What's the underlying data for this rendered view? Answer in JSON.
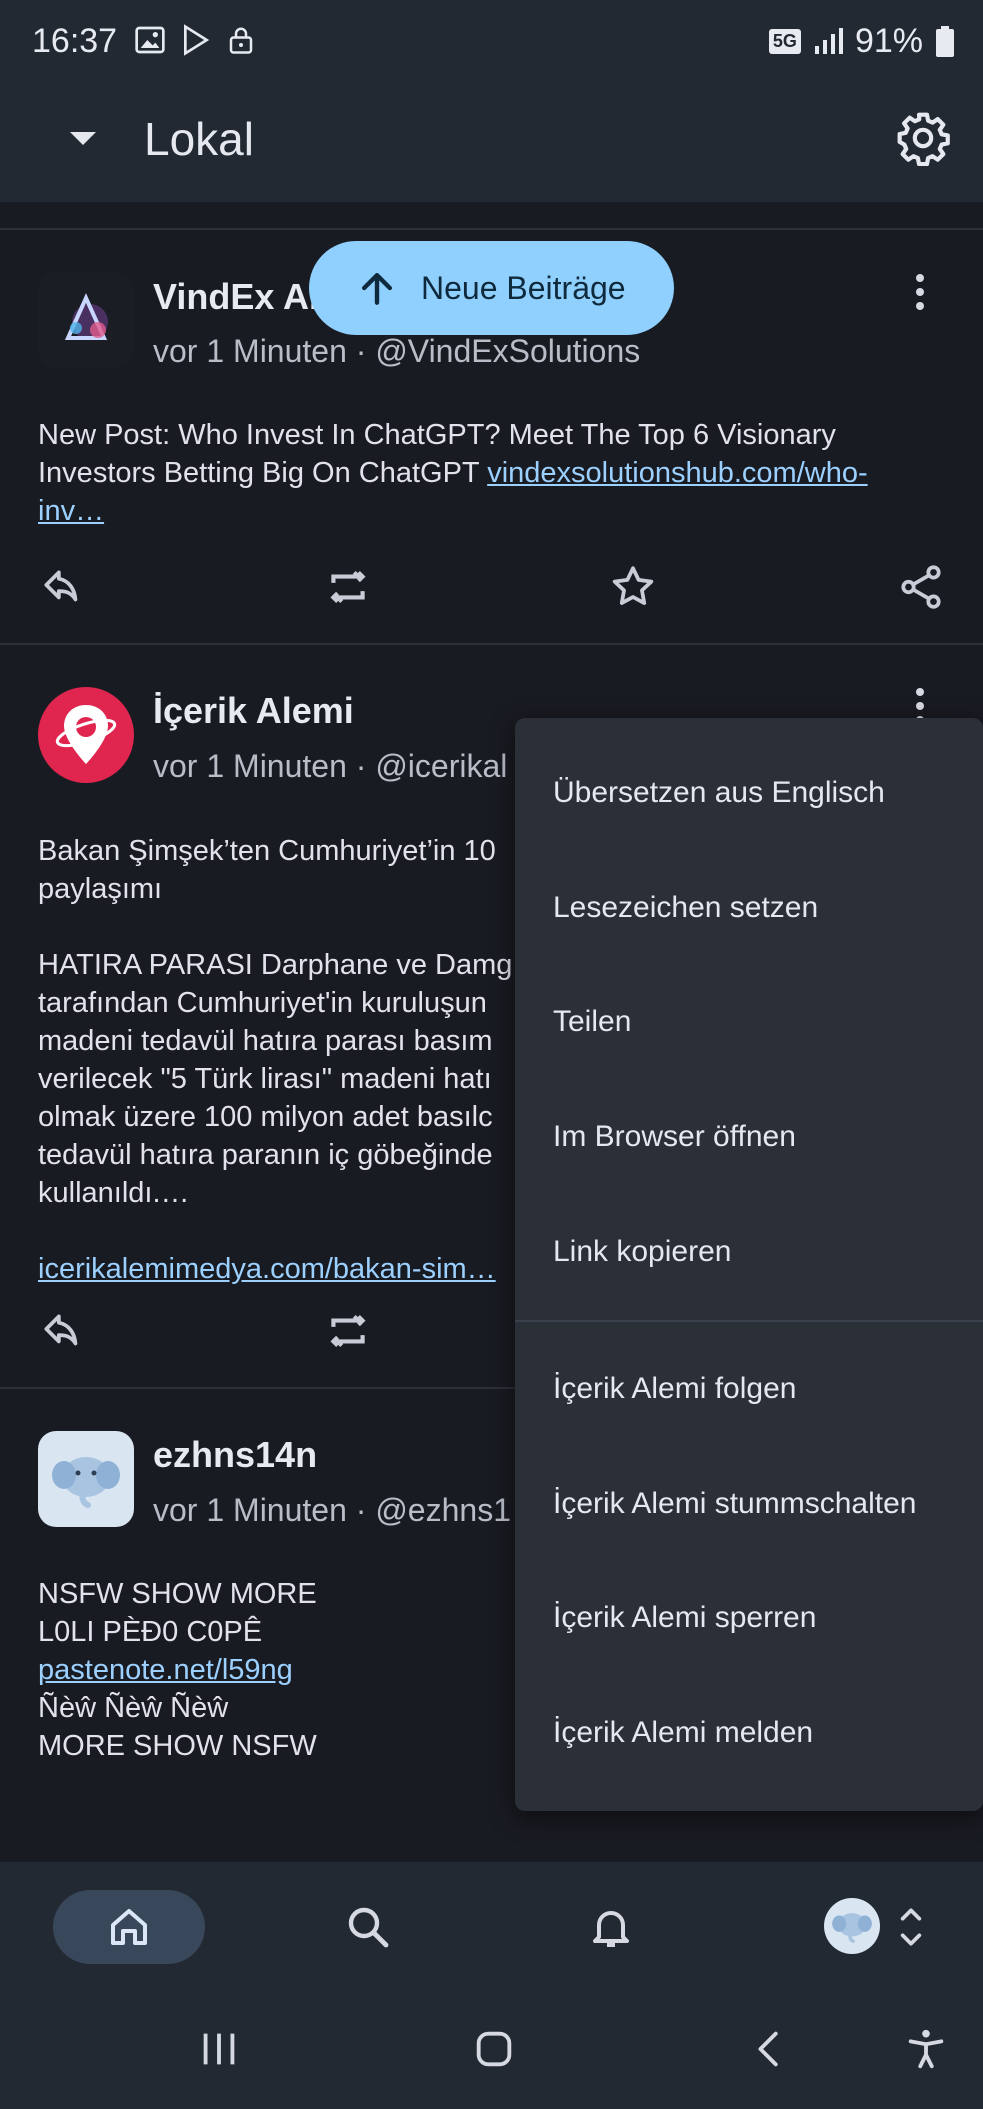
{
  "status_bar": {
    "time": "16:37",
    "network": "5G",
    "battery": "91%"
  },
  "app_bar": {
    "title": "Lokal"
  },
  "new_posts_pill": {
    "label": "Neue Beiträge"
  },
  "posts": [
    {
      "name": "VindEx AI",
      "time": "vor 1 Minuten",
      "handle": "@VindExSolutions",
      "text": "New Post: Who Invest In ChatGPT? Meet The Top 6 Visionary Investors Betting Big On ChatGPT ",
      "link": "vindexsolutionshub.com/who-inv…"
    },
    {
      "name": "İçerik Alemi",
      "time": "vor 1 Minuten",
      "handle": "@icerikal",
      "text_lines": [
        "Bakan Şimşek’ten Cumhuriyet’in 10",
        "paylaşımı",
        "",
        "HATIRA PARASI Darphane ve Damg",
        "tarafından Cumhuriyet'in kuruluşun",
        "madeni tedavül hatıra parası basım",
        "verilecek \"5 Türk lirası\" madeni hatı",
        "olmak üzere 100 milyon adet basılc",
        "tedavül hatıra paranın iç göbeğinde",
        "kullanıldı.…"
      ],
      "link": "icerikalemimedya.com/bakan-sim…"
    },
    {
      "name": "ezhns14n",
      "time": "vor 1 Minuten",
      "handle": "@ezhns1",
      "line1": "NSFW SHOW MORE",
      "line2": "L0LI PÈĐ0 C0PÊ",
      "link": "pastenote.net/l59ng",
      "line3": "Ñèŵ Ñèŵ Ñèŵ",
      "line4": "MORE SHOW NSFW"
    }
  ],
  "menu": {
    "items": [
      "Übersetzen aus Englisch",
      "Lesezeichen setzen",
      "Teilen",
      "Im Browser öffnen",
      "Link kopieren",
      "İçerik Alemi folgen",
      "İçerik Alemi stummschalten",
      "İçerik Alemi sperren",
      "İçerik Alemi melden"
    ]
  },
  "icons": {
    "status": [
      "image-icon",
      "play-store-icon",
      "lock-icon",
      "signal-icon",
      "battery-icon"
    ],
    "app_bar": [
      "dropdown-caret-icon",
      "settings-gear-icon"
    ],
    "post_actions": [
      "reply-icon",
      "boost-icon",
      "favourite-star-icon",
      "share-icon"
    ],
    "bottom_nav": [
      "home-icon",
      "search-icon",
      "notifications-bell-icon",
      "account-avatar",
      "account-switch-icon"
    ],
    "system_nav": [
      "recent-apps-icon",
      "home-circle-icon",
      "back-icon",
      "accessibility-icon"
    ]
  },
  "colors": {
    "background": "#191b22",
    "bar": "#232933",
    "accent": "#8fd0ff",
    "link": "#9bd0ff"
  }
}
